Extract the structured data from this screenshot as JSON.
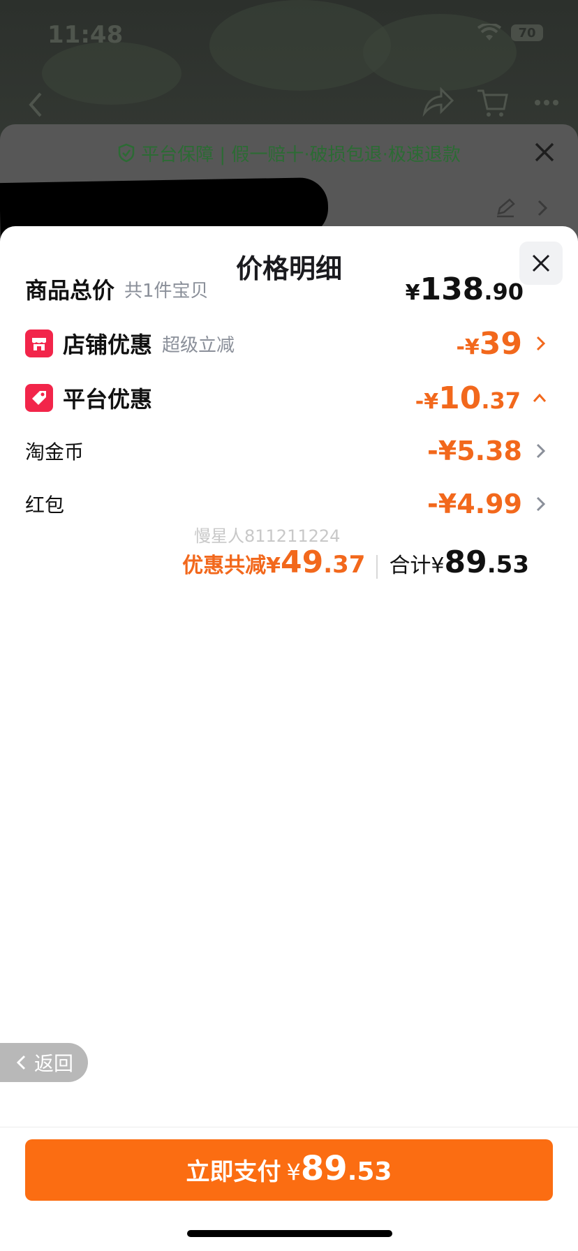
{
  "status_bar": {
    "time": "11:48",
    "battery": "70"
  },
  "under_sheet": {
    "guarantee_text": "平台保障 | 假一赔十·破损包退·极速退款"
  },
  "sheet": {
    "title": "价格明细",
    "rows": [
      {
        "label": "商品总价",
        "sub": "共1件宝贝",
        "amount_sign": "¥",
        "amount_int": "138",
        "amount_dec": ".90"
      },
      {
        "label": "店铺优惠",
        "sub": "超级立减",
        "amount_sign": "-¥",
        "amount_int": "39",
        "amount_dec": ""
      },
      {
        "label": "平台优惠",
        "sub": "",
        "amount_sign": "-¥",
        "amount_int": "10",
        "amount_dec": ".37"
      },
      {
        "label": "淘金币",
        "sub": "",
        "amount_sign": "-¥",
        "amount_int": "5.38",
        "amount_dec": ""
      },
      {
        "label": "红包",
        "sub": "",
        "amount_sign": "-¥",
        "amount_int": "4.99",
        "amount_dec": ""
      }
    ],
    "watermark": "慢星人811211224",
    "summary": {
      "discount_label": "优惠共减¥",
      "discount_int": "49",
      "discount_dec": ".37",
      "total_label": "合计¥",
      "total_int": "89",
      "total_dec": ".53"
    },
    "back_label": "返回",
    "pay": {
      "label": "立即支付",
      "currency": "¥",
      "int": "89",
      "dec": ".53"
    }
  },
  "colors": {
    "accent_orange": "#f2681c",
    "pay_button": "#fb6d12",
    "tag_red": "#f2254a",
    "guarantee_green": "#2c6b34"
  },
  "icons": {
    "store": "store-icon",
    "coupon": "coupon-tag-icon",
    "close": "close-icon",
    "chevron_right": "chevron-right-icon",
    "chevron_up": "chevron-up-icon",
    "shield": "shield-check-icon",
    "back": "chevron-left-icon"
  }
}
